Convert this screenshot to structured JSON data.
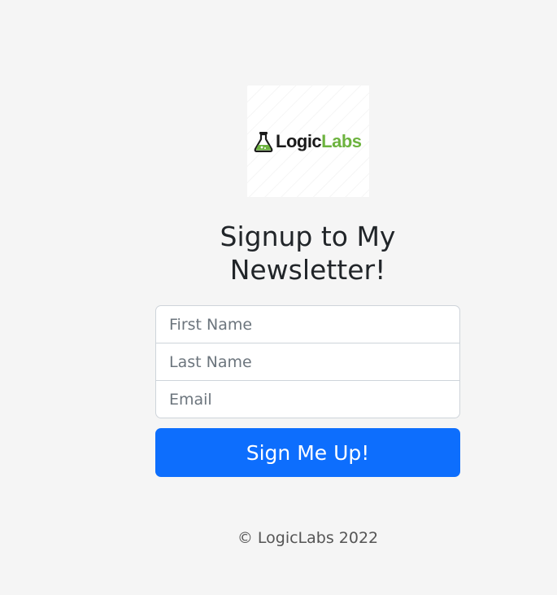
{
  "logo": {
    "icon": "flask-icon",
    "text_part1": "Logic",
    "text_part2": "Labs",
    "colors": {
      "dark": "#1a1a1a",
      "green": "#6db33f"
    }
  },
  "heading": "Signup to My Newsletter!",
  "form": {
    "first_name_placeholder": "First Name",
    "last_name_placeholder": "Last Name",
    "email_placeholder": "Email",
    "submit_label": "Sign Me Up!"
  },
  "footer": {
    "copyright": "© LogicLabs 2022"
  },
  "colors": {
    "background": "#f5f5f5",
    "button": "#0d6efd",
    "button_text": "#ffffff"
  }
}
